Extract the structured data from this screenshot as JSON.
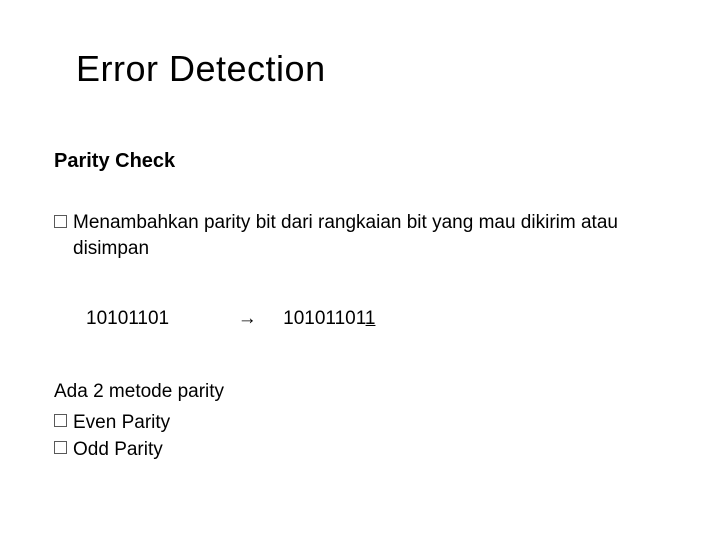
{
  "title": "Error Detection",
  "subtitle": "Parity Check",
  "bullet1": "Menambahkan parity bit dari rangkaian bit yang mau dikirim atau disimpan",
  "example": {
    "input": "10101101",
    "arrow": "→",
    "output_prefix": "10101101",
    "output_parity": "1"
  },
  "methods": {
    "intro": "Ada 2 metode parity",
    "item1": "Even Parity",
    "item2": "Odd Parity"
  }
}
